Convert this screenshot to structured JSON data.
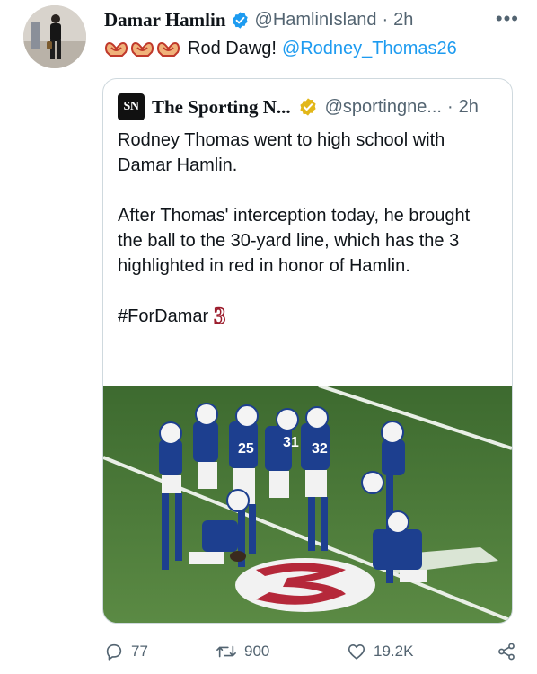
{
  "tweet": {
    "author_name": "Damar Hamlin",
    "author_handle": "@HamlinIsland",
    "separator": "·",
    "time": "2h",
    "more": "•••",
    "text": "Rod Dawg!",
    "mention": "@Rodney_Thomas26",
    "emoji": "heart-hands-icon"
  },
  "quote": {
    "logo": "SN",
    "name": "The Sporting N...",
    "handle": "@sportingne...",
    "separator": "·",
    "time": "2h",
    "paragraph1": "Rodney Thomas went to high school with Damar Hamlin.",
    "paragraph2": "After Thomas' interception today, he brought the ball to the 30-yard line, which has the 3 highlighted in red in honor of Hamlin.",
    "hashtag": "#ForDamar",
    "hashtag_emoji": "3"
  },
  "actions": {
    "replies": "77",
    "retweets": "900",
    "likes": "19.2K"
  },
  "colors": {
    "link": "#1d9bf0",
    "muted": "#536471",
    "verified_blue": "#1d9bf0",
    "verified_gold": "#e2b719",
    "field_green": "#4f7a3c",
    "jersey_blue": "#1d3f8f",
    "tribute_red": "#b5283a"
  }
}
